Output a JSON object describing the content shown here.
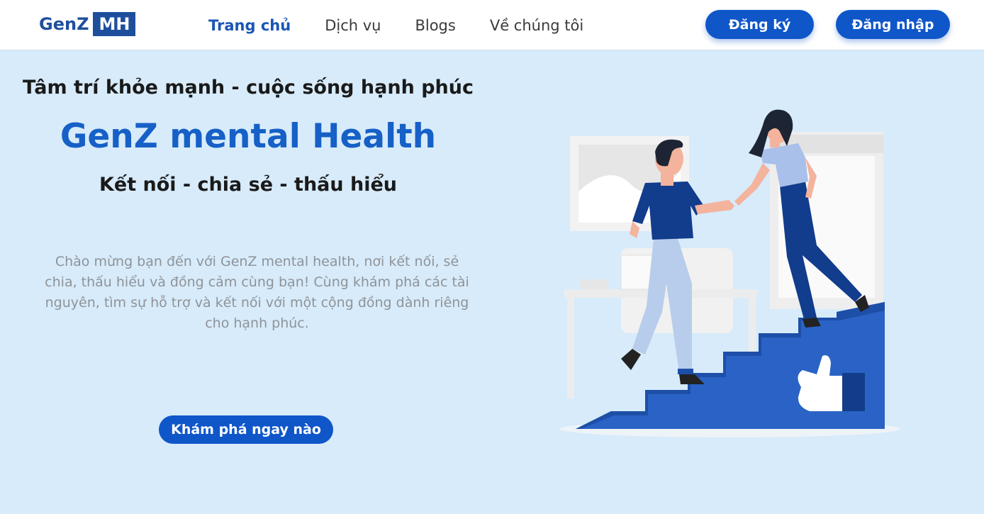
{
  "header": {
    "logo": {
      "text": "GenZ",
      "badge": "MH"
    },
    "nav": [
      {
        "label": "Trang chủ",
        "active": true
      },
      {
        "label": "Dịch vụ",
        "active": false
      },
      {
        "label": "Blogs",
        "active": false
      },
      {
        "label": "Về chúng tôi",
        "active": false
      }
    ],
    "register_label": "Đăng ký",
    "login_label": "Đăng nhập"
  },
  "hero": {
    "tagline": "Tâm trí khỏe mạnh - cuộc sống hạnh phúc",
    "brand": "GenZ mental Health",
    "motto": "Kết nối - chia sẻ - thấu hiểu",
    "intro": "Chào mừng bạn đến với GenZ mental health, nơi kết nối, sẻ chia, thấu hiểu và đồng cảm cùng bạn! Cùng khám phá các tài nguyên, tìm sự hỗ trợ và kết nối với một cộng đồng dành riêng cho hạnh phúc.",
    "cta_label": "Khám phá ngay nào"
  },
  "colors": {
    "primary": "#0f56c9",
    "brand_text": "#1660c7",
    "background": "#d7ebfa",
    "logo": "#1e4f9c"
  },
  "icons": {
    "illustration": "people-helping-up-stairs-illustration",
    "thumbs_up": "thumbs-up-icon"
  }
}
